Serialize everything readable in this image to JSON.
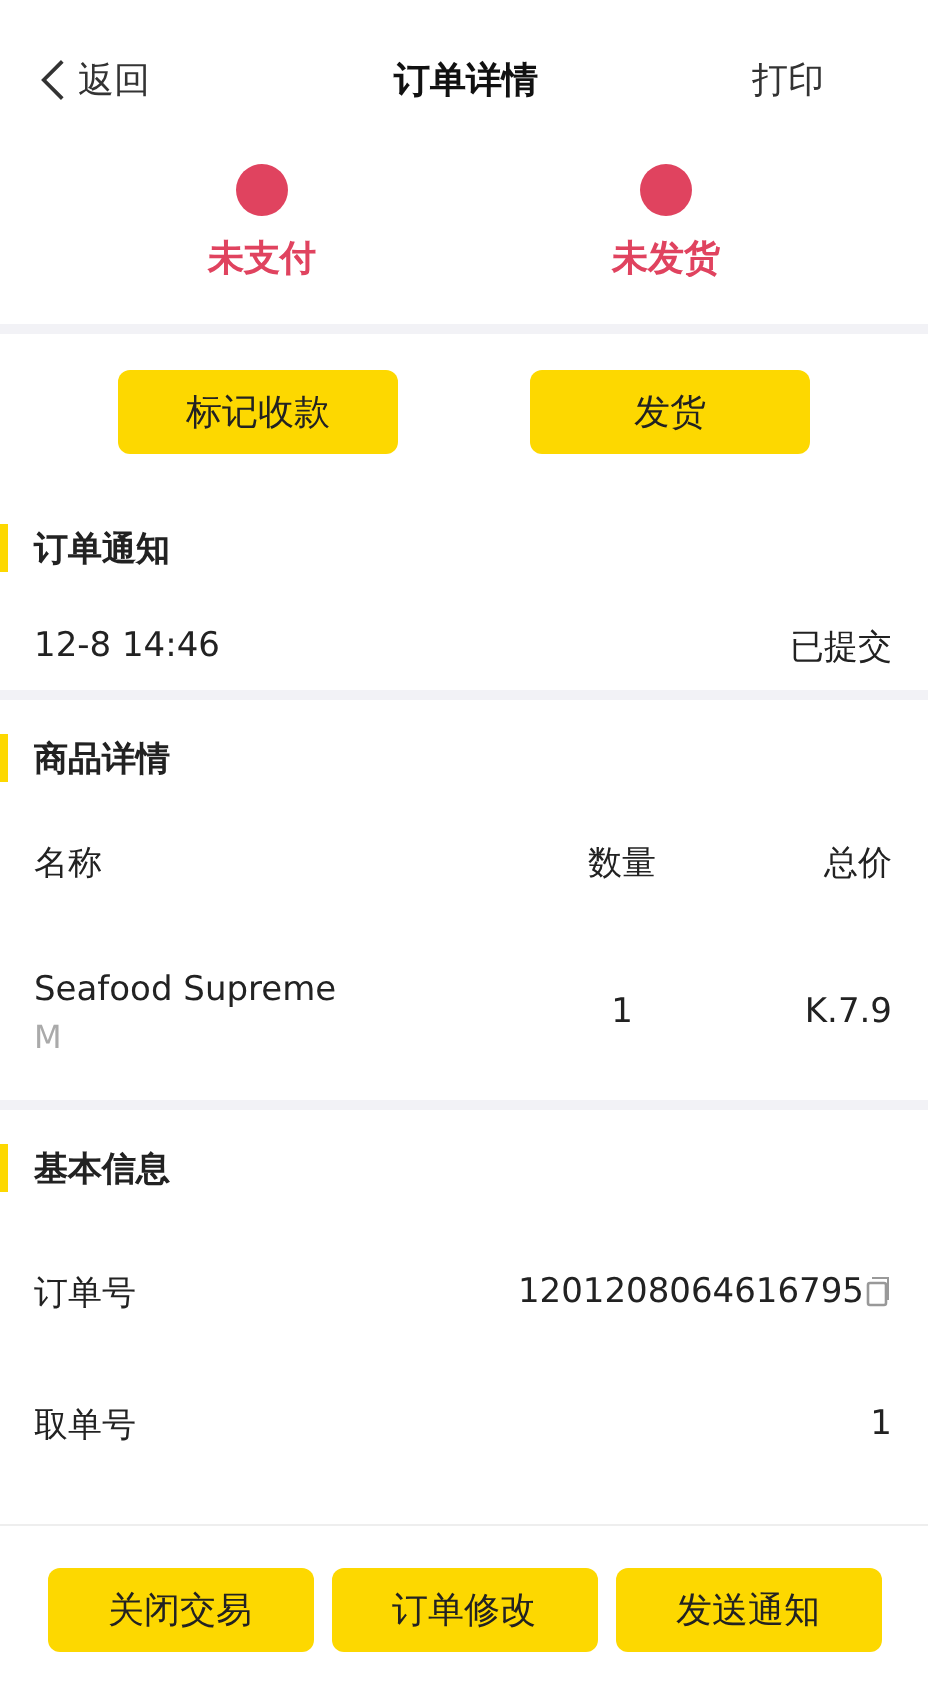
{
  "nav": {
    "back": "返回",
    "title": "订单详情",
    "action": "打印"
  },
  "statuses": [
    {
      "label": "未支付",
      "color": "#e0435f"
    },
    {
      "label": "未发货",
      "color": "#e0435f"
    }
  ],
  "actions": [
    "标记收款",
    "发货"
  ],
  "notice": {
    "title": "订单通知",
    "time": "12-8 14:46",
    "state": "已提交"
  },
  "goods": {
    "title": "商品详情",
    "columns": [
      "名称",
      "数量",
      "总价"
    ],
    "rows": [
      {
        "name": "Seafood Supreme",
        "variant": "M",
        "quantity": "1",
        "total": "K.7.9"
      }
    ]
  },
  "info": {
    "title": "基本信息",
    "rows": [
      {
        "label": "订单号",
        "value": "1201208064616795",
        "copyable": true
      },
      {
        "label": "取单号",
        "value": "1",
        "copyable": false
      }
    ]
  },
  "bottom_buttons": [
    "关闭交易",
    "订单修改",
    "发送通知"
  ]
}
